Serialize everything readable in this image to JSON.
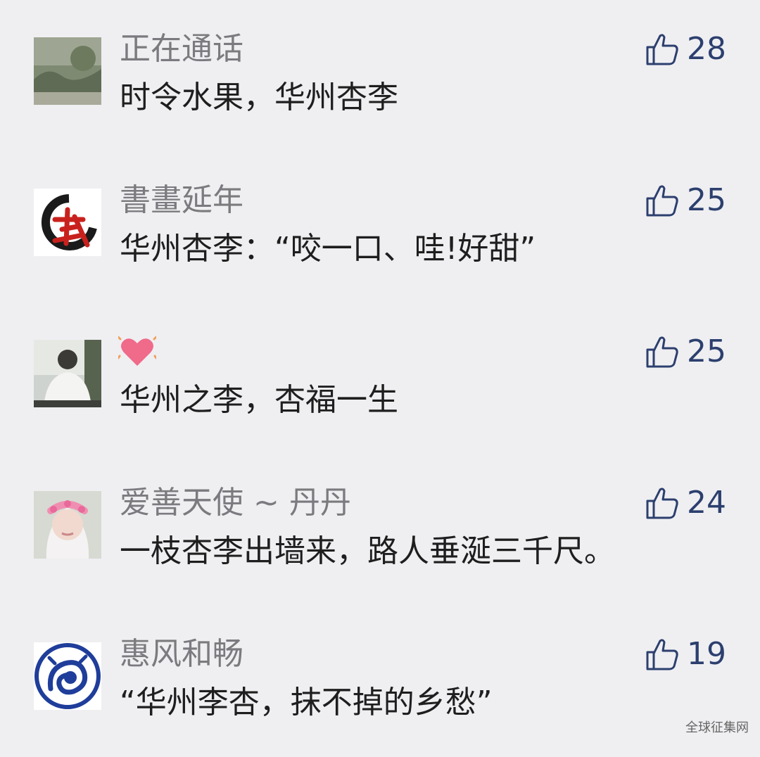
{
  "comments": [
    {
      "nickname": "正在通话",
      "text": "时令水果，华州杏李",
      "likes": "28",
      "avatar": "landscape-photo-avatar"
    },
    {
      "nickname": "書畫延年",
      "text": "华州杏李：“咬一口、哇!好甜”",
      "likes": "25",
      "avatar": "calligraphy-wu-avatar"
    },
    {
      "nickname": "",
      "nickname_icon": "heart-icon",
      "text": "华州之李，杏福一生",
      "likes": "25",
      "avatar": "person-back-photo-avatar"
    },
    {
      "nickname": "爱善天使 ~ 丹丹",
      "text": "一枝杏李出墙来，路人垂涎三千尺。",
      "likes": "24",
      "avatar": "flower-crown-girl-avatar"
    },
    {
      "nickname": "惠风和畅",
      "text": "“华州李杏，抹不掉的乡愁”",
      "likes": "19",
      "avatar": "blue-dragon-seal-avatar"
    }
  ],
  "watermark": "全球征集网",
  "colors": {
    "background": "#efeff2",
    "nickname": "#7b7b7f",
    "text": "#1e1e1e",
    "like": "#2c3f6e",
    "heart": "#f06a8a"
  }
}
